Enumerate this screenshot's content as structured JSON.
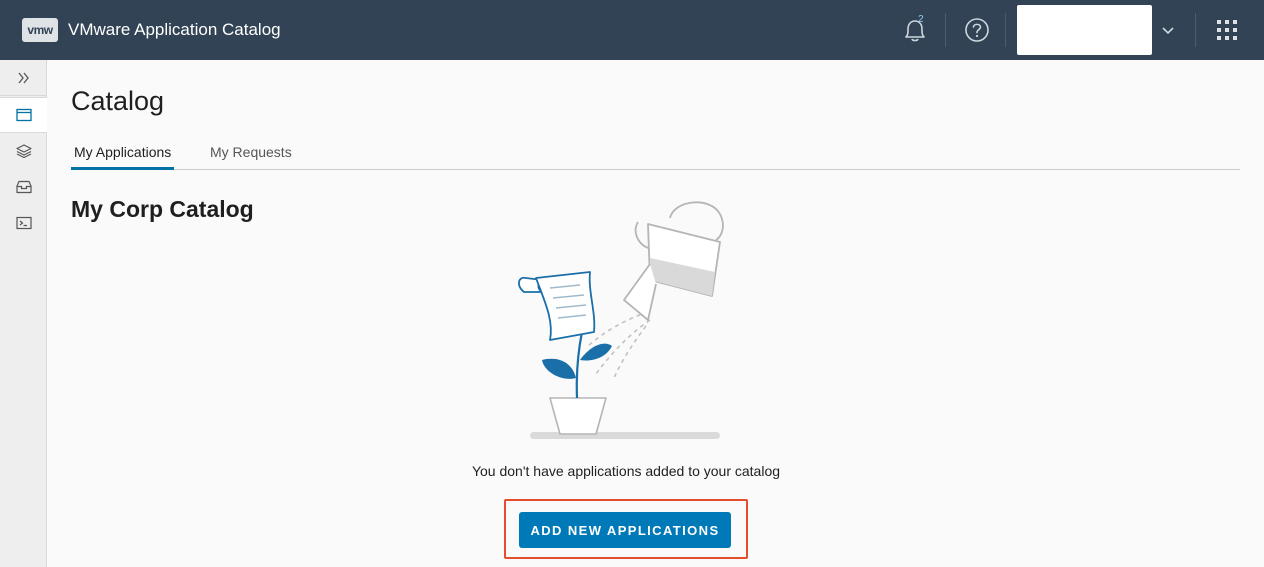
{
  "header": {
    "logo_text": "vmw",
    "app_title": "VMware Application Catalog",
    "notification_count": "2",
    "icons": [
      "bell-icon",
      "help-icon",
      "chevron-down-icon",
      "apps-grid-icon"
    ],
    "colors": {
      "bar": "#314355",
      "badge": "#8fd0f5"
    }
  },
  "sidebar": {
    "items": [
      {
        "icon": "double-chevron-right-icon",
        "active": false
      },
      {
        "icon": "browser-icon",
        "active": true
      },
      {
        "icon": "layers-icon",
        "active": false
      },
      {
        "icon": "inbox-icon",
        "active": false
      },
      {
        "icon": "terminal-icon",
        "active": false
      }
    ]
  },
  "main": {
    "title": "Catalog",
    "tabs": [
      {
        "label": "My Applications",
        "active": true
      },
      {
        "label": "My Requests",
        "active": false
      }
    ],
    "section_title": "My Corp Catalog",
    "empty_message": "You don't have applications added to your catalog",
    "add_button_label": "ADD NEW APPLICATIONS",
    "colors": {
      "accent": "#0079b8",
      "highlight_border": "#e44e2e"
    }
  }
}
